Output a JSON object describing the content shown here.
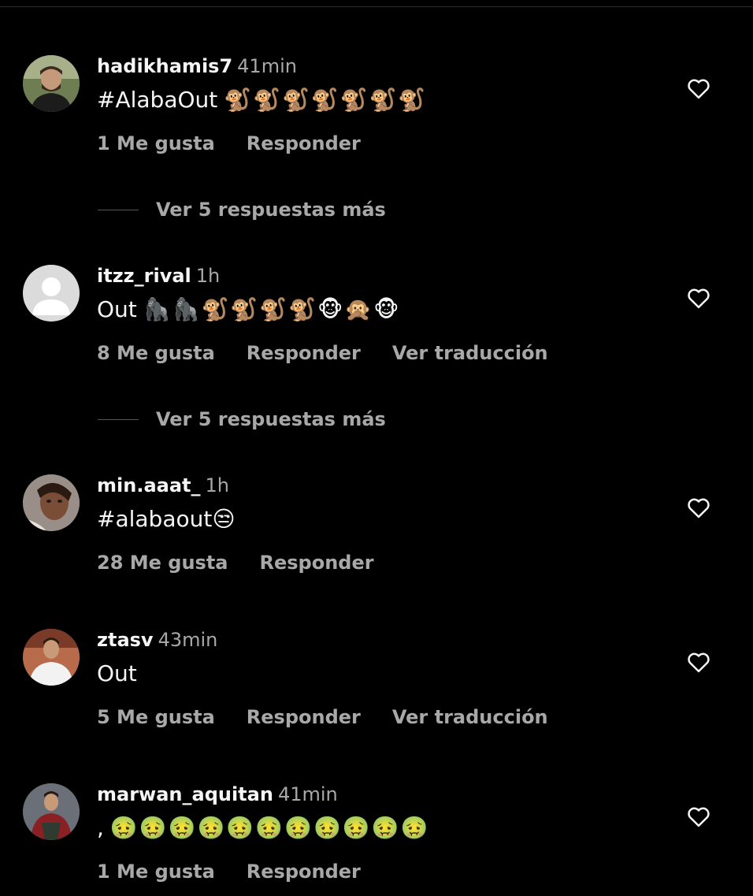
{
  "comments": [
    {
      "username": "hadikhamis7",
      "time": "41min",
      "text": "#AlabaOut",
      "emojis": "🐒🐒🐒🐒🐒🐒🐒",
      "likes": "1 Me gusta",
      "reply": "Responder",
      "translate": ""
    },
    {
      "username": "itzz_rival",
      "time": "1h",
      "text": "Out",
      "emojis": "🦍🦍🐒🐒🐒🐒🐵🙊🐵",
      "likes": "8 Me gusta",
      "reply": "Responder",
      "translate": "Ver traducción"
    },
    {
      "username": "min.aaat_",
      "time": "1h",
      "text": "#alabaout",
      "emojis": "😒",
      "likes": "28 Me gusta",
      "reply": "Responder",
      "translate": ""
    },
    {
      "username": "ztasv",
      "time": "43min",
      "text": "Out",
      "emojis": "",
      "likes": "5 Me gusta",
      "reply": "Responder",
      "translate": "Ver traducción"
    },
    {
      "username": "marwan_aquitan",
      "time": "41min",
      "text": ",",
      "emojis": "🤢🤢🤢🤢🤢🤢🤢🤢🤢🤢🤢",
      "likes": "1 Me gusta",
      "reply": "Responder",
      "translate": ""
    }
  ],
  "replies": [
    {
      "label": "Ver 5 respuestas más"
    },
    {
      "label": "Ver 5 respuestas más"
    }
  ],
  "colors": {
    "background": "#000000",
    "primary_text": "#f5f5f5",
    "secondary_text": "#a8a8a8"
  },
  "icons": {
    "heart": "heart-outline-icon"
  }
}
